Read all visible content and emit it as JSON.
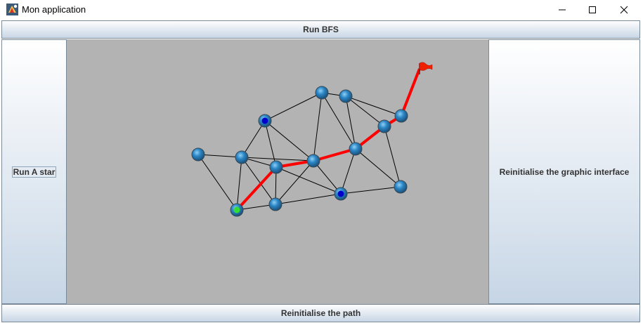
{
  "window": {
    "title": "Mon application",
    "icons": {
      "app": "java-app-icon",
      "minimize": "minimize-icon",
      "maximize": "maximize-icon",
      "close": "close-icon"
    }
  },
  "buttons": {
    "run_bfs": "Run BFS",
    "run_astar": "Run A star",
    "reinit_gui": "Reinitialise the graphic interface",
    "reinit_path": "Reinitialise the path"
  },
  "graph": {
    "colors": {
      "background": "#b3b3b3",
      "edge": "#000000",
      "path": "#ff0000",
      "node": "#2b86c5",
      "start_node": "#33dd33",
      "visited_node": "#0000cc",
      "goal_flag": "#ee2200"
    },
    "goal_icon": "red-flag-icon",
    "nodes": [
      {
        "id": "n1",
        "state": "normal"
      },
      {
        "id": "n2",
        "state": "normal"
      },
      {
        "id": "n3",
        "state": "visited"
      },
      {
        "id": "n4",
        "state": "normal"
      },
      {
        "id": "n5",
        "state": "normal"
      },
      {
        "id": "n6",
        "state": "normal"
      },
      {
        "id": "n7",
        "state": "normal"
      },
      {
        "id": "n8",
        "state": "normal"
      },
      {
        "id": "n9",
        "state": "normal"
      },
      {
        "id": "n10",
        "state": "normal"
      },
      {
        "id": "n11",
        "state": "start"
      },
      {
        "id": "n12",
        "state": "normal"
      },
      {
        "id": "n13",
        "state": "visited"
      },
      {
        "id": "n14",
        "state": "normal"
      },
      {
        "id": "goal",
        "state": "goal"
      }
    ],
    "edges": [
      [
        "n1",
        "n2"
      ],
      [
        "n1",
        "n7"
      ],
      [
        "n1",
        "n8"
      ],
      [
        "n2",
        "n7"
      ],
      [
        "n2",
        "n8"
      ],
      [
        "n2",
        "n9"
      ],
      [
        "n7",
        "n3"
      ],
      [
        "n3",
        "n6"
      ],
      [
        "n3",
        "n4"
      ],
      [
        "n4",
        "n6"
      ],
      [
        "n4",
        "n5"
      ],
      [
        "n4",
        "n8"
      ],
      [
        "n5",
        "n8"
      ],
      [
        "n5",
        "n9"
      ],
      [
        "n5",
        "n10"
      ],
      [
        "n5",
        "goal"
      ],
      [
        "n9",
        "n13"
      ],
      [
        "n9",
        "n14"
      ],
      [
        "n10",
        "n14"
      ],
      [
        "n13",
        "n14"
      ],
      [
        "n6",
        "n11"
      ],
      [
        "n6",
        "n12"
      ],
      [
        "n6",
        "n13"
      ],
      [
        "n6",
        "n7"
      ],
      [
        "n7",
        "n11"
      ],
      [
        "n7",
        "n12"
      ],
      [
        "n11",
        "n12"
      ],
      [
        "n12",
        "n13"
      ],
      [
        "n6",
        "n8"
      ]
    ],
    "path": [
      "n11",
      "n7",
      "n6",
      "n8",
      "n9",
      "n10",
      "goal"
    ]
  }
}
